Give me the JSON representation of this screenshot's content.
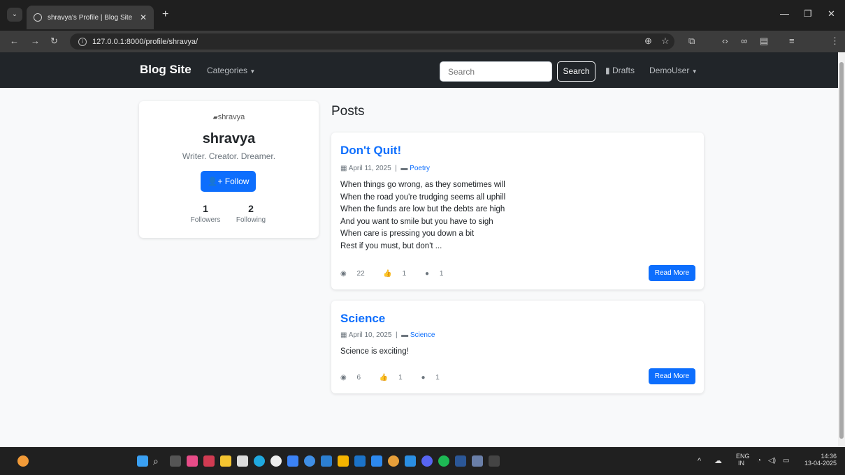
{
  "browser": {
    "tab_title": "shravya's Profile | Blog Site",
    "url": "127.0.0.1:8000/profile/shravya/"
  },
  "navbar": {
    "brand": "Blog Site",
    "categories_label": "Categories",
    "search_placeholder": "Search",
    "search_button": "Search",
    "drafts_label": "Drafts",
    "user_label": "DemoUser"
  },
  "profile": {
    "image_alt": "shravya",
    "name": "shravya",
    "bio": "Writer. Creator. Dreamer.",
    "follow_button": "Follow",
    "followers_count": "1",
    "followers_label": "Followers",
    "following_count": "2",
    "following_label": "Following"
  },
  "posts_heading": "Posts",
  "posts": [
    {
      "title": "Don't Quit!",
      "date": "April 11, 2025",
      "category": "Poetry",
      "body_lines": [
        "When things go wrong, as they sometimes will",
        "When the road you're trudging seems all uphill",
        "When the funds are low but the debts are high",
        "And you want to smile but you have to sigh",
        "When care is pressing you down a bit",
        "Rest if you must, but don't ..."
      ],
      "views": "22",
      "likes": "1",
      "comments": "1",
      "read_more": "Read More"
    },
    {
      "title": "Science",
      "date": "April 10, 2025",
      "category": "Science",
      "body_lines": [
        "Science is exciting!"
      ],
      "views": "6",
      "likes": "1",
      "comments": "1",
      "read_more": "Read More"
    }
  ],
  "taskbar": {
    "lang_top": "ENG",
    "lang_bottom": "IN",
    "time": "14:36",
    "date": "13-04-2025"
  },
  "colors": {
    "primary": "#0d6efd",
    "navbar": "#212529",
    "page_bg": "#f8f9fa"
  }
}
